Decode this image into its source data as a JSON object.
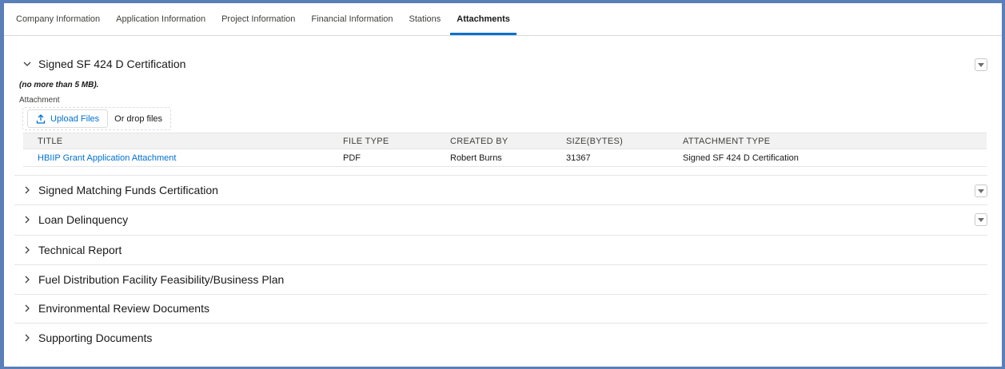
{
  "tabs": [
    {
      "label": "Company Information"
    },
    {
      "label": "Application Information"
    },
    {
      "label": "Project Information"
    },
    {
      "label": "Financial Information"
    },
    {
      "label": "Stations"
    },
    {
      "label": "Attachments",
      "active": true
    }
  ],
  "sections": [
    {
      "title": "Signed SF 424 D Certification",
      "expanded": true,
      "has_menu": true
    },
    {
      "title": "Signed Matching Funds Certification",
      "expanded": false,
      "has_menu": true
    },
    {
      "title": "Loan Delinquency",
      "expanded": false,
      "has_menu": true
    },
    {
      "title": "Technical Report",
      "expanded": false,
      "has_menu": false
    },
    {
      "title": "Fuel Distribution Facility Feasibility/Business Plan",
      "expanded": false,
      "has_menu": false
    },
    {
      "title": "Environmental Review Documents",
      "expanded": false,
      "has_menu": false
    },
    {
      "title": "Supporting Documents",
      "expanded": false,
      "has_menu": false
    }
  ],
  "upload": {
    "size_note": "(no more than 5 MB).",
    "field_label": "Attachment",
    "button_label": "Upload Files",
    "drop_text": "Or drop files"
  },
  "table": {
    "headers": [
      "TITLE",
      "FILE TYPE",
      "CREATED BY",
      "SIZE(BYTES)",
      "ATTACHMENT TYPE"
    ],
    "rows": [
      {
        "title": "HBIIP Grant Application Attachment",
        "file_type": "PDF",
        "created_by": "Robert Burns",
        "size": "31367",
        "attachment_type": "Signed SF 424 D Certification"
      }
    ]
  },
  "colors": {
    "accent": "#0070d2",
    "frame": "#5b7fb8"
  }
}
